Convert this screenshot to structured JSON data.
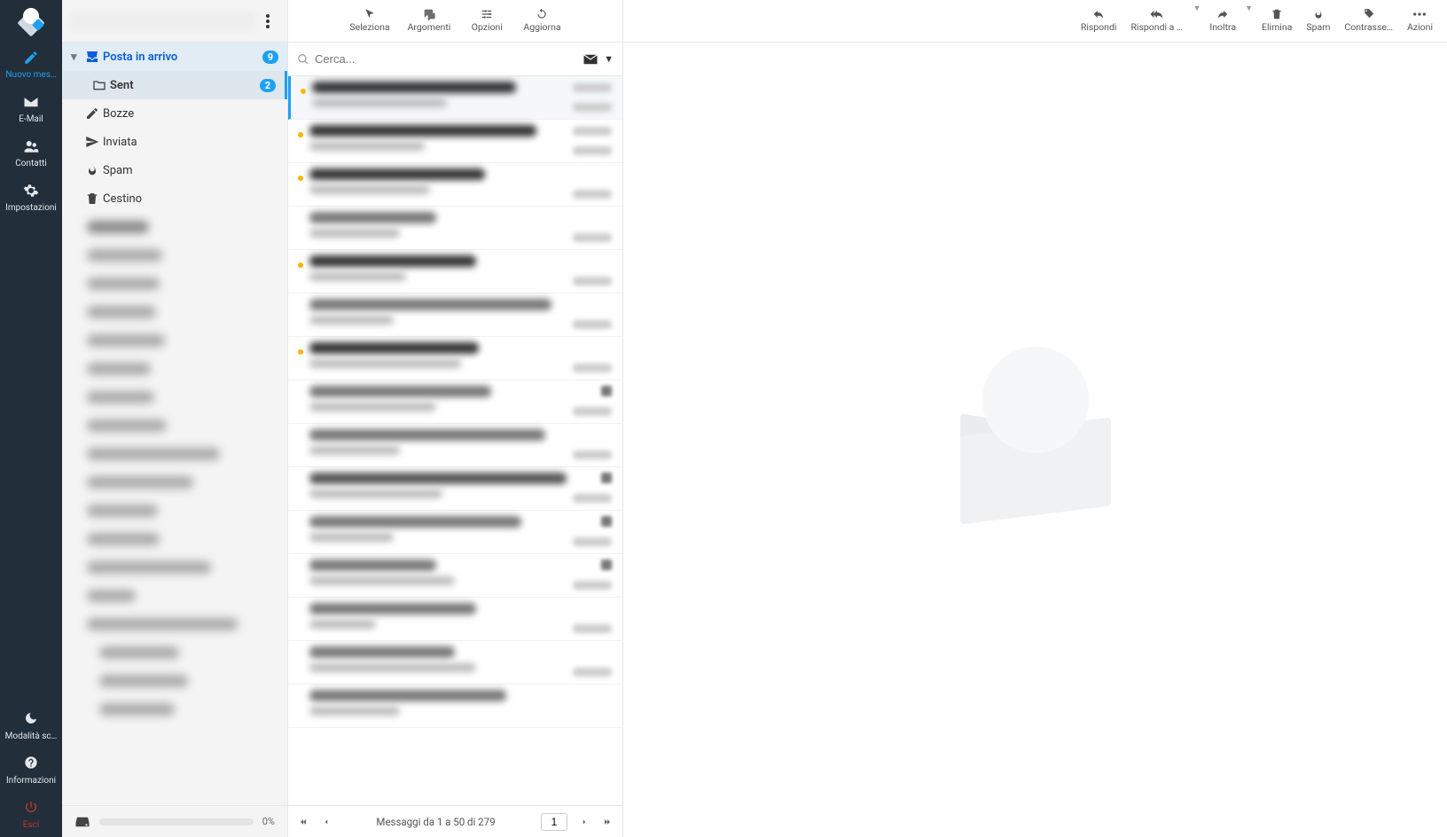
{
  "sidebar": {
    "compose": "Nuovo mes…",
    "email": "E-Mail",
    "contacts": "Contatti",
    "settings": "Impostazioni",
    "darkmode": "Modalità sc…",
    "info": "Informazioni",
    "logout": "Esci"
  },
  "folders": {
    "inbox": "Posta in arrivo",
    "inbox_count": "9",
    "sent": "Sent",
    "sent_count": "2",
    "drafts": "Bozze",
    "sent2": "Inviata",
    "spam": "Spam",
    "trash": "Cestino"
  },
  "storage": {
    "pct": "0%"
  },
  "list_toolbar": {
    "select": "Seleziona",
    "threads": "Argomenti",
    "options": "Opzioni",
    "refresh": "Aggiorna"
  },
  "search": {
    "placeholder": "Cerca..."
  },
  "pager": {
    "text": "Messaggi da 1 a 50 di 279",
    "page": "1"
  },
  "viewer_toolbar": {
    "reply": "Rispondi",
    "reply_all": "Rispondi a t…",
    "forward": "Inoltra",
    "delete": "Elimina",
    "spam": "Spam",
    "mark": "Contrasse…",
    "actions": "Azioni"
  }
}
